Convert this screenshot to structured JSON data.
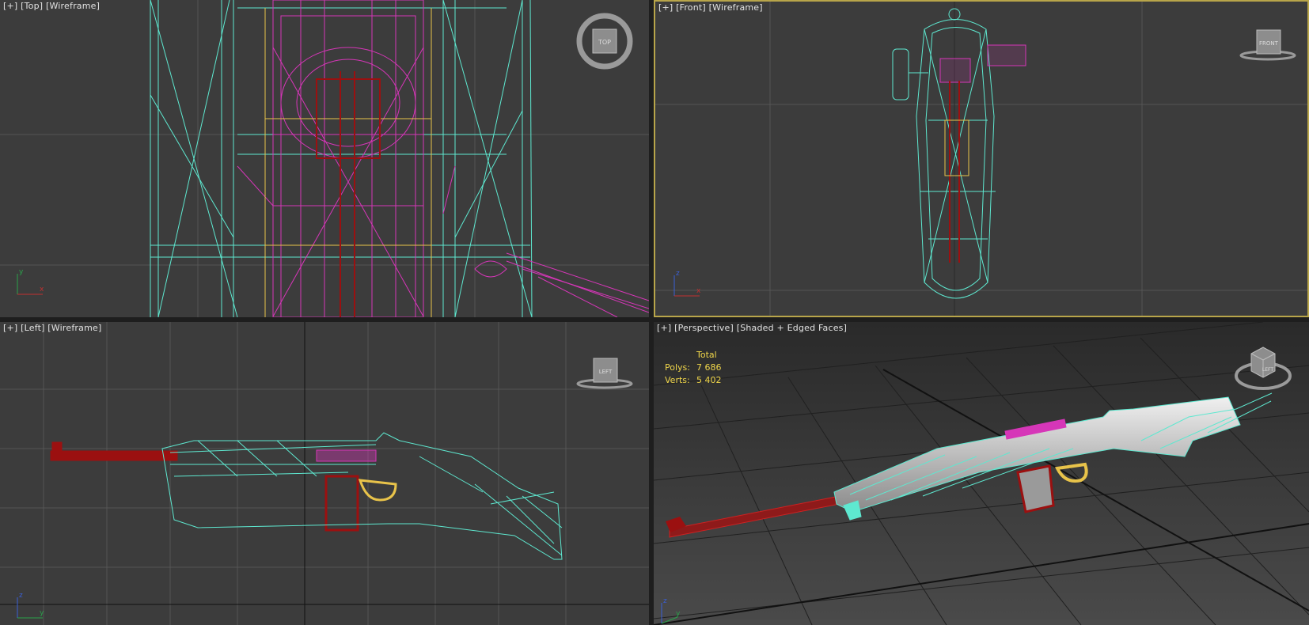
{
  "viewports": {
    "top": {
      "menu": "[+]",
      "view": "[Top]",
      "shading": "[Wireframe]",
      "cube_label": "TOP"
    },
    "front": {
      "menu": "[+]",
      "view": "[Front]",
      "shading": "[Wireframe]",
      "cube_label": "FRONT"
    },
    "left": {
      "menu": "[+]",
      "view": "[Left]",
      "shading": "[Wireframe]",
      "cube_label": "LEFT"
    },
    "perspective": {
      "menu": "[+]",
      "view": "[Perspective]",
      "shading": "[Shaded + Edged Faces]",
      "cube_label": "LEFT"
    }
  },
  "stats": {
    "header": "Total",
    "polys_label": "Polys:",
    "polys_value": "7 686",
    "verts_label": "Verts:",
    "verts_value": "5 402"
  },
  "axis_labels": {
    "top": [
      "y",
      "x"
    ],
    "front": [
      "z",
      "x"
    ],
    "left": [
      "z",
      "y"
    ],
    "perspective": [
      "z",
      "y"
    ]
  },
  "colors": {
    "viewport_bg": "#3c3c3c",
    "grid": "#555555",
    "active_border": "#b8a54a",
    "stock_wire": "#5ee8d0",
    "barrel_wire": "#9b1010",
    "receiver_wire": "#d636b8",
    "trigger_wire": "#e8c34a"
  }
}
